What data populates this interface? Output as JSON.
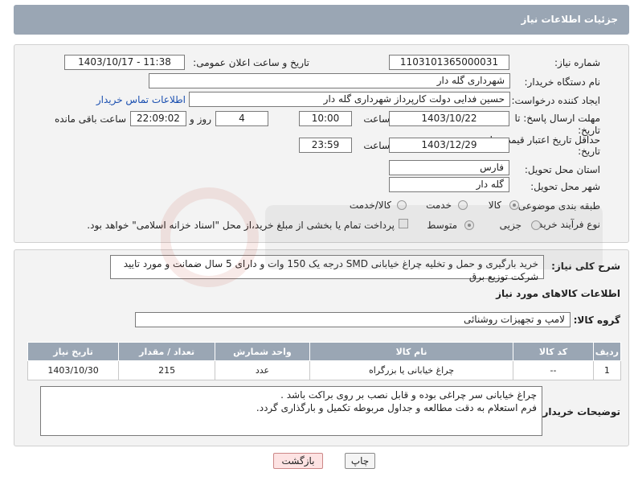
{
  "header": {
    "title": "جزئیات اطلاعات نیاز"
  },
  "form": {
    "need_number_label": "شماره نیاز:",
    "need_number": "1103101365000031",
    "announce_label": "تاریخ و ساعت اعلان عمومی:",
    "announce_value": "1403/10/17 - 11:38",
    "buyer_org_label": "نام دستگاه خریدار:",
    "buyer_org": "شهرداری گله دار",
    "creator_label": "ایجاد کننده درخواست:",
    "creator": "حسین فدایی دولت کارپرداز شهرداری گله دار",
    "buyer_contact_link": "اطلاعات تماس خریدار",
    "reply_deadline_label_1": "مهلت ارسال پاسخ: تا",
    "reply_deadline_label_2": "تاریخ:",
    "reply_date": "1403/10/22",
    "time_label": "ساعت",
    "reply_time": "10:00",
    "days_value": "4",
    "days_label": "روز و",
    "remaining_time": "22:09:02",
    "remaining_label": "ساعت باقی مانده",
    "validity_label_1": "حداقل تاریخ اعتبار قیمت: تا",
    "validity_label_2": "تاریخ:",
    "validity_date": "1403/12/29",
    "validity_time_label": "ساعت",
    "validity_time": "23:59",
    "province_label": "استان محل تحویل:",
    "province": "فارس",
    "city_label": "شهر محل تحویل:",
    "city": "گله دار",
    "category_label": "طبقه بندی موضوعی:",
    "category_options": [
      "کالا",
      "خدمت",
      "کالا/خدمت"
    ],
    "category_selected": "کالا",
    "purchase_type_label": "نوع فرآیند خرید :",
    "purchase_options": [
      "جزیی",
      "متوسط"
    ],
    "purchase_selected": "متوسط",
    "payment_note": "پرداخت تمام یا بخشی از مبلغ خرید،از محل \"اسناد خزانه اسلامی\" خواهد بود."
  },
  "description": {
    "label": "شرح کلی نیاز:",
    "text": "خرید بارگیری و حمل و تخلیه چراغ خیابانی SMD درجه یک 150 وات و دارای 5 سال ضمانت و مورد تایید شرکت توزیع برق"
  },
  "goods": {
    "section_title": "اطلاعات کالاهای مورد نیاز",
    "group_label": "گروه کالا:",
    "group_value": "لامپ و تجهیزات روشنائی",
    "columns": [
      "ردیف",
      "کد کالا",
      "نام کالا",
      "واحد شمارش",
      "تعداد / مقدار",
      "تاریخ نیاز"
    ],
    "rows": [
      {
        "row": "1",
        "code": "--",
        "name": "چراغ خیابانی یا بزرگراه",
        "unit": "عدد",
        "qty": "215",
        "date": "1403/10/30"
      }
    ]
  },
  "buyer_notes": {
    "label": "توضیحات خریدار:",
    "line1": "چراغ خیابانی سر چراغی بوده و قابل نصب بر روی براکت باشد .",
    "line2": "فرم استعلام به دقت مطالعه و جداول مربوطه تکمیل و بارگذاری گردد."
  },
  "buttons": {
    "print": "چاپ",
    "back": "بازگشت"
  },
  "colors": {
    "header": "#9aa6b4",
    "panel": "#f3f3f3",
    "link": "#1a4fb0"
  }
}
